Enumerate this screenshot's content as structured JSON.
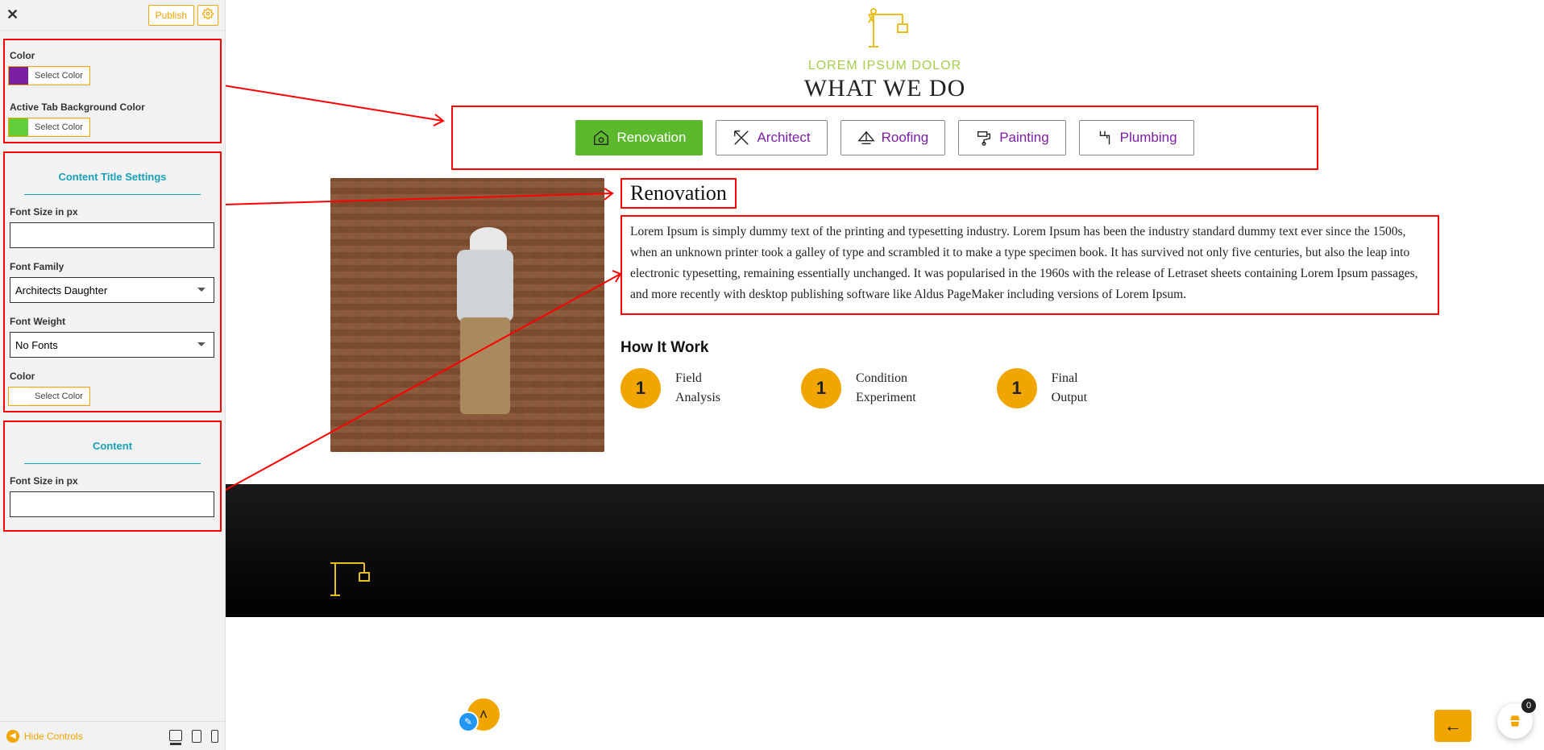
{
  "sidebar": {
    "publish": "Publish",
    "box1": {
      "color_label": "Color",
      "active_bg_label": "Active Tab Background Color",
      "select_color": "Select Color"
    },
    "box2": {
      "section_title_a": "Content ",
      "section_title_b": "Title Settings",
      "font_size_label": "Font Size in px",
      "font_size_value": "",
      "font_family_label": "Font Family",
      "font_family_value": "Architects Daughter",
      "font_weight_label": "Font Weight",
      "font_weight_value": "No Fonts",
      "color_label": "Color",
      "select_color": "Select Color"
    },
    "box3": {
      "section_title": "Content",
      "font_size_label": "Font Size in px",
      "font_size_value": ""
    },
    "hide_controls": "Hide Controls"
  },
  "preview": {
    "subtitle": "LOREM IPSUM DOLOR",
    "title": "WHAT WE DO",
    "tabs": [
      {
        "label": "Renovation",
        "active": true
      },
      {
        "label": "Architect",
        "active": false
      },
      {
        "label": "Roofing",
        "active": false
      },
      {
        "label": "Painting",
        "active": false
      },
      {
        "label": "Plumbing",
        "active": false
      }
    ],
    "content_title": "Renovation",
    "content_body": "Lorem Ipsum is simply dummy text of the printing and typesetting industry. Lorem Ipsum has been the industry standard dummy text ever since the 1500s, when an unknown printer took a galley of type and scrambled it to make a type specimen book. It has survived not only five centuries, but also the leap into electronic typesetting, remaining essentially unchanged. It was popularised in the 1960s with the release of Letraset sheets containing Lorem Ipsum passages, and more recently with desktop publishing software like Aldus PageMaker including versions of Lorem Ipsum.",
    "how_title": "How It Work",
    "steps": [
      {
        "num": "1",
        "line1": "Field",
        "line2": "Analysis"
      },
      {
        "num": "1",
        "line1": "Condition",
        "line2": "Experiment"
      },
      {
        "num": "1",
        "line1": "Final",
        "line2": "Output"
      }
    ],
    "cart_count": "0"
  }
}
